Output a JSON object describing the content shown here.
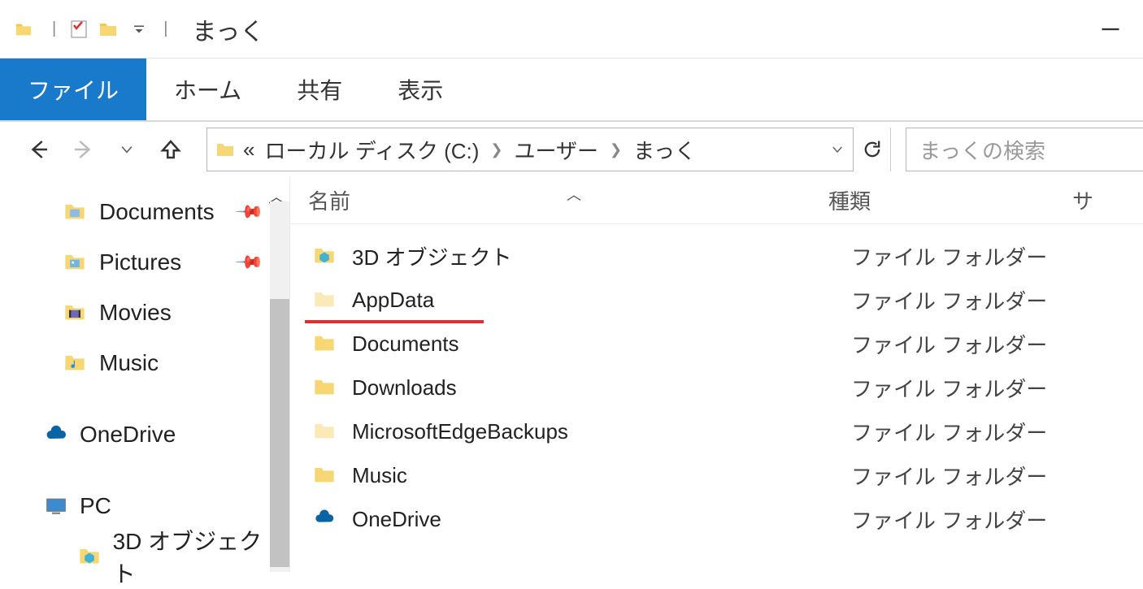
{
  "titlebar": {
    "title": "まっく"
  },
  "ribbon": {
    "file": "ファイル",
    "home": "ホーム",
    "share": "共有",
    "view": "表示"
  },
  "breadcrumb": {
    "prefix": "«",
    "parts": [
      "ローカル ディスク (C:)",
      "ユーザー",
      "まっく"
    ]
  },
  "search": {
    "placeholder": "まっくの検索"
  },
  "columns": {
    "name": "名前",
    "type": "種類",
    "last": "サ"
  },
  "sidebar": {
    "items": [
      {
        "label": "Documents",
        "icon": "doc-lib",
        "pinned": true
      },
      {
        "label": "Pictures",
        "icon": "pic-lib",
        "pinned": true
      },
      {
        "label": "Movies",
        "icon": "movie-lib",
        "pinned": false
      },
      {
        "label": "Music",
        "icon": "music-lib",
        "pinned": false
      }
    ],
    "onedrive": "OneDrive",
    "pc": "PC",
    "pc_children": [
      {
        "label": "3D オブジェクト",
        "icon": "3d-folder"
      }
    ]
  },
  "files": [
    {
      "name": "3D オブジェクト",
      "type": "ファイル フォルダー",
      "icon": "3d-folder"
    },
    {
      "name": "AppData",
      "type": "ファイル フォルダー",
      "icon": "folder-light",
      "underlined": true
    },
    {
      "name": "Documents",
      "type": "ファイル フォルダー",
      "icon": "folder"
    },
    {
      "name": "Downloads",
      "type": "ファイル フォルダー",
      "icon": "folder"
    },
    {
      "name": "MicrosoftEdgeBackups",
      "type": "ファイル フォルダー",
      "icon": "folder-light"
    },
    {
      "name": "Music",
      "type": "ファイル フォルダー",
      "icon": "folder"
    },
    {
      "name": "OneDrive",
      "type": "ファイル フォルダー",
      "icon": "onedrive"
    }
  ]
}
